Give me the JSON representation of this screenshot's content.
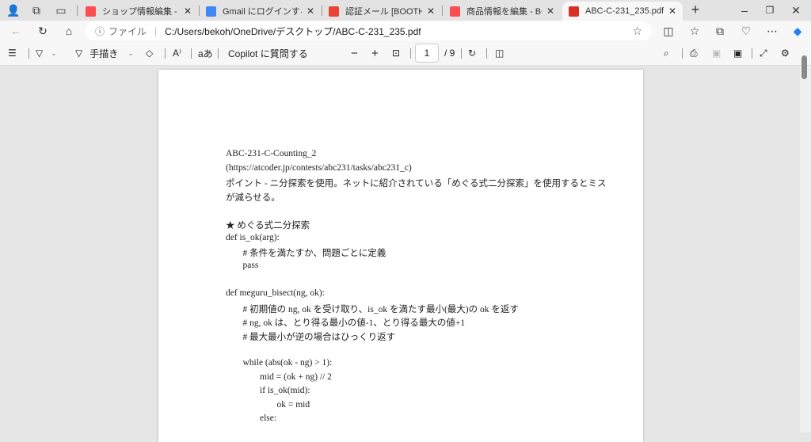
{
  "tabs": [
    {
      "label": "ショップ情報編集 - BOOTH",
      "icon": "booth-icon",
      "color": "#fc4d50"
    },
    {
      "label": "Gmail にログインする - パソコ",
      "icon": "google-icon",
      "color": "#4285f4"
    },
    {
      "label": "認証メール [BOOTH] - koab",
      "icon": "gmail-icon",
      "color": "#ea4335"
    },
    {
      "label": "商品情報を編集 - BOOTH",
      "icon": "booth-icon",
      "color": "#fc4d50"
    },
    {
      "label": "ABC-C-231_235.pdf",
      "icon": "pdf-icon",
      "color": "#d93025",
      "active": true
    }
  ],
  "address": {
    "scheme_label": "ファイル",
    "url": "C:/Users/bekoh/OneDrive/デスクトップ/ABC-C-231_235.pdf"
  },
  "pdf_toolbar": {
    "draw_label": "手描き",
    "read_aloud": "A⁾",
    "translate": "aあ",
    "copilot_label": "Copilot に質問する",
    "page_current": "1",
    "page_total": "/ 9"
  },
  "document": {
    "lines": [
      {
        "text": "ABC-231-C-Counting_2",
        "indent": 0
      },
      {
        "text": "(https://atcoder.jp/contests/abc231/tasks/abc231_c)",
        "indent": 0
      },
      {
        "text": "ポイント - ニ分探索を使用。ネットに紹介されている「めぐる式二分探索」を使用するとミス",
        "indent": 0
      },
      {
        "text": "が減らせる。",
        "indent": 0
      },
      {
        "text": "★ めぐる式二分探索",
        "indent": 0,
        "gap": true
      },
      {
        "text": "def is_ok(arg):",
        "indent": 0
      },
      {
        "text": "# 条件を満たすか、問題ごとに定義",
        "indent": 1
      },
      {
        "text": "pass",
        "indent": 1
      },
      {
        "text": "def meguru_bisect(ng, ok):",
        "indent": 0,
        "gap": true
      },
      {
        "text": "# 初期値の ng, ok を受け取り、is_ok を満たす最小(最大)の ok を返す",
        "indent": 1
      },
      {
        "text": "# ng, ok は、とり得る最小の値-1、とり得る最大の値+1",
        "indent": 1
      },
      {
        "text": "# 最大最小が逆の場合はひっくり返す",
        "indent": 1
      },
      {
        "text": "while (abs(ok - ng) > 1):",
        "indent": 1,
        "gap": true
      },
      {
        "text": "mid = (ok + ng) // 2",
        "indent": 2
      },
      {
        "text": "if is_ok(mid):",
        "indent": 2
      },
      {
        "text": "ok = mid",
        "indent": 3
      },
      {
        "text": "else:",
        "indent": 2
      }
    ]
  }
}
